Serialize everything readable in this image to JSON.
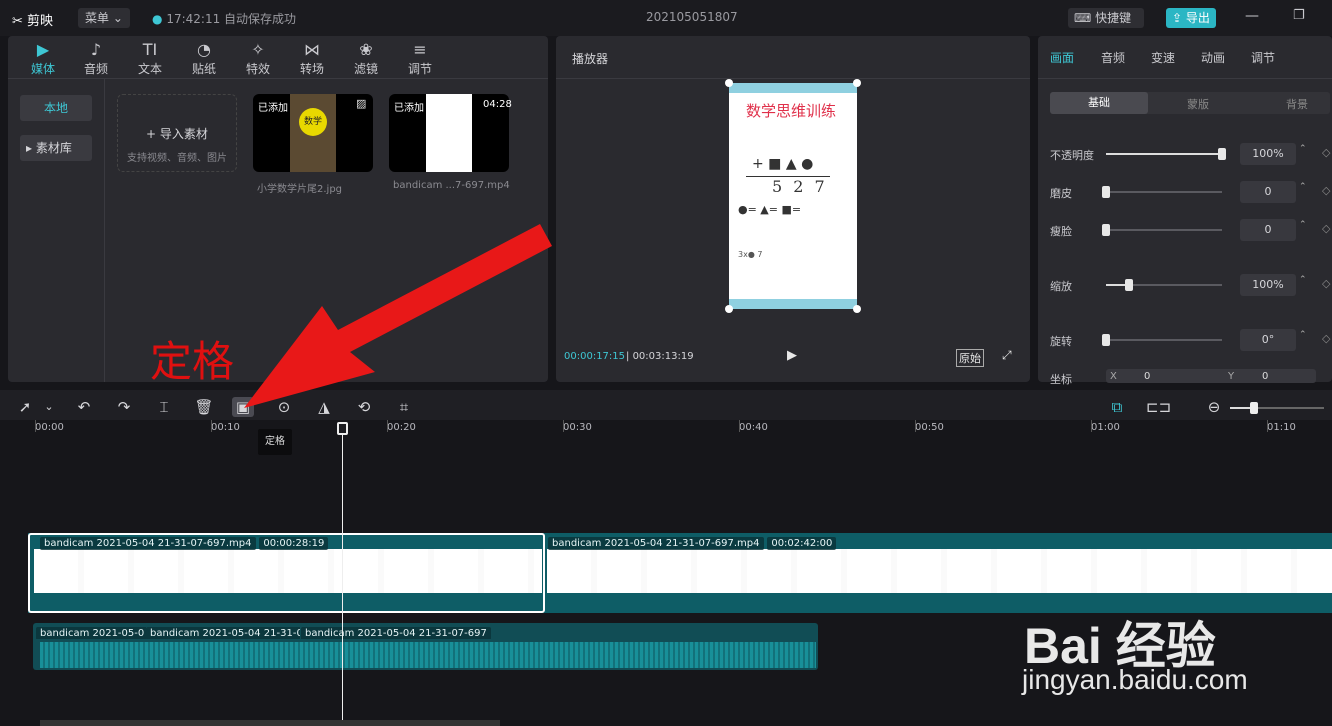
{
  "app": {
    "title": "剪映",
    "menu_label": "菜单",
    "autosave": "17:42:11 自动保存成功",
    "project_name": "202105051807",
    "shortcut_label": "快捷键",
    "export_label": "导出",
    "accent": "#3ec7d4"
  },
  "media_nav": [
    {
      "label": "媒体",
      "icon": "media-icon"
    },
    {
      "label": "音频",
      "icon": "audio-icon"
    },
    {
      "label": "文本",
      "icon": "text-icon"
    },
    {
      "label": "贴纸",
      "icon": "sticker-icon"
    },
    {
      "label": "特效",
      "icon": "effects-icon"
    },
    {
      "label": "转场",
      "icon": "transition-icon"
    },
    {
      "label": "滤镜",
      "icon": "filter-icon"
    },
    {
      "label": "调节",
      "icon": "adjust-icon"
    }
  ],
  "media_side": {
    "local": "本地",
    "library": "素材库"
  },
  "import": {
    "label": "导入素材",
    "hint": "支持视频、音频、图片"
  },
  "media_items": [
    {
      "badge": "已添加",
      "name": "小学数学片尾2.jpg",
      "thumb_text": "数学"
    },
    {
      "badge": "已添加",
      "name": "bandicam ...7-697.mp4",
      "duration": "04:28"
    }
  ],
  "player": {
    "title": "播放器",
    "current": "00:00:17:15",
    "total": "00:03:13:19",
    "ratio_label": "原始",
    "video_title": "数学思维训练",
    "row1": "+ ■ ▲ ●",
    "sum": "5 2 7",
    "legend": "●=  ▲=  ■=",
    "note": "3x●  7"
  },
  "props": {
    "tabs": [
      "画面",
      "音频",
      "变速",
      "动画",
      "调节"
    ],
    "subtabs": [
      "基础",
      "蒙版",
      "背景"
    ],
    "rows": [
      {
        "label": "不透明度",
        "value": "100%",
        "pos": 1.0
      },
      {
        "label": "磨皮",
        "value": "0",
        "pos": 0
      },
      {
        "label": "瘦脸",
        "value": "0",
        "pos": 0
      },
      {
        "label": "缩放",
        "value": "100%",
        "pos": 0.2
      },
      {
        "label": "旋转",
        "value": "0°",
        "pos": 0
      }
    ],
    "coord_label": "坐标",
    "x_label": "X",
    "x_value": "0",
    "y_label": "Y",
    "y_value": "0"
  },
  "annotation": {
    "text": "定格",
    "color": "#e01010"
  },
  "tooltip": "定格",
  "ruler": [
    "00:00",
    "00:10",
    "00:20",
    "00:30",
    "00:40",
    "00:50",
    "01:00",
    "01:10"
  ],
  "clips": {
    "video1_name": "bandicam 2021-05-04 21-31-07-697.mp4",
    "video1_dur": "00:00:28:19",
    "video2_name": "bandicam 2021-05-04 21-31-07-697.mp4",
    "video2_dur": "00:02:42:00",
    "audio_labels": [
      "bandicam 2021-05-0",
      "bandicam 2021-05-04 21-31-0",
      "bandicam 2021-05-04 21-31-07-697"
    ]
  },
  "watermark": {
    "brand": "Bai  经验",
    "url": "jingyan.baidu.com"
  }
}
